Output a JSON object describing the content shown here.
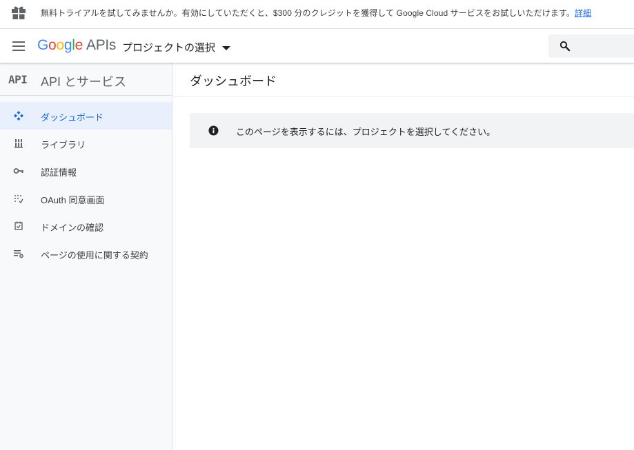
{
  "promo": {
    "text": "無料トライアルを試してみませんか。有効にしていただくと、$300 分のクレジットを獲得して Google Cloud サービスをお試しいただけます。",
    "link": "詳細"
  },
  "header": {
    "logo_letters": [
      "G",
      "o",
      "o",
      "g",
      "l",
      "e"
    ],
    "logo_suffix": "APIs",
    "project_select": "プロジェクトの選択"
  },
  "sidebar": {
    "badge": "API",
    "title": "API とサービス",
    "items": [
      {
        "label": "ダッシュボード",
        "icon": "dashboard-icon",
        "active": true
      },
      {
        "label": "ライブラリ",
        "icon": "library-icon",
        "active": false
      },
      {
        "label": "認証情報",
        "icon": "key-icon",
        "active": false
      },
      {
        "label": "OAuth 同意画面",
        "icon": "consent-screen-icon",
        "active": false
      },
      {
        "label": "ドメインの確認",
        "icon": "domain-check-icon",
        "active": false
      },
      {
        "label": "ページの使用に関する契約",
        "icon": "page-usage-settings-icon",
        "active": false
      }
    ]
  },
  "main": {
    "title": "ダッシュボード",
    "notice": "このページを表示するには、プロジェクトを選択してください。"
  },
  "colors": {
    "accent": "#1a73e8",
    "active_bg": "#e8f0fe",
    "active_text": "#1967d2",
    "sidebar_bg": "#f8f9fa",
    "notice_bg": "#f1f3f4"
  }
}
